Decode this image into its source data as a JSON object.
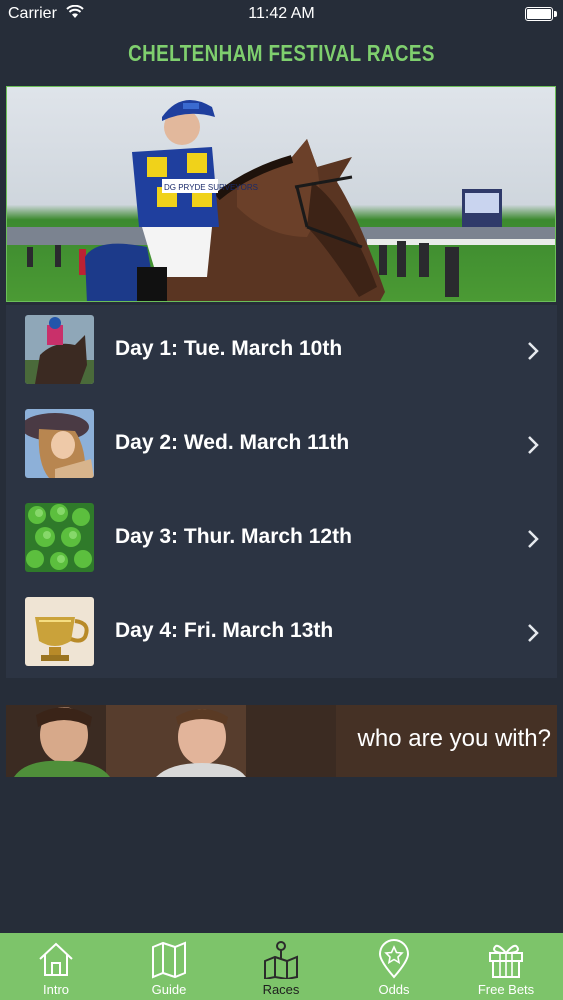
{
  "status_bar": {
    "carrier": "Carrier",
    "time": "11:42 AM"
  },
  "header": {
    "title": "CHELTENHAM FESTIVAL RACES"
  },
  "hero": {
    "jockey_silks_text": "DG PRYDE SURVEYORS"
  },
  "races": [
    {
      "label": "Day 1: Tue. March 10th",
      "thumb": "horse-race-thumb"
    },
    {
      "label": "Day 2: Wed. March 11th",
      "thumb": "lady-in-hat-thumb"
    },
    {
      "label": "Day 3: Thur. March 12th",
      "thumb": "shamrock-thumb"
    },
    {
      "label": "Day 4: Fri. March 13th",
      "thumb": "gold-cup-thumb"
    }
  ],
  "ad_banner": {
    "text": "who are you with?"
  },
  "tabs": [
    {
      "label": "Intro",
      "icon": "house-icon"
    },
    {
      "label": "Guide",
      "icon": "map-icon"
    },
    {
      "label": "Races",
      "icon": "map-pin-icon"
    },
    {
      "label": "Odds",
      "icon": "location-star-icon"
    },
    {
      "label": "Free Bets",
      "icon": "gift-icon"
    }
  ],
  "colors": {
    "background": "#262d39",
    "list_background": "#2c3443",
    "accent_green": "#7fcf6e",
    "tab_bar": "#7dc46a"
  }
}
